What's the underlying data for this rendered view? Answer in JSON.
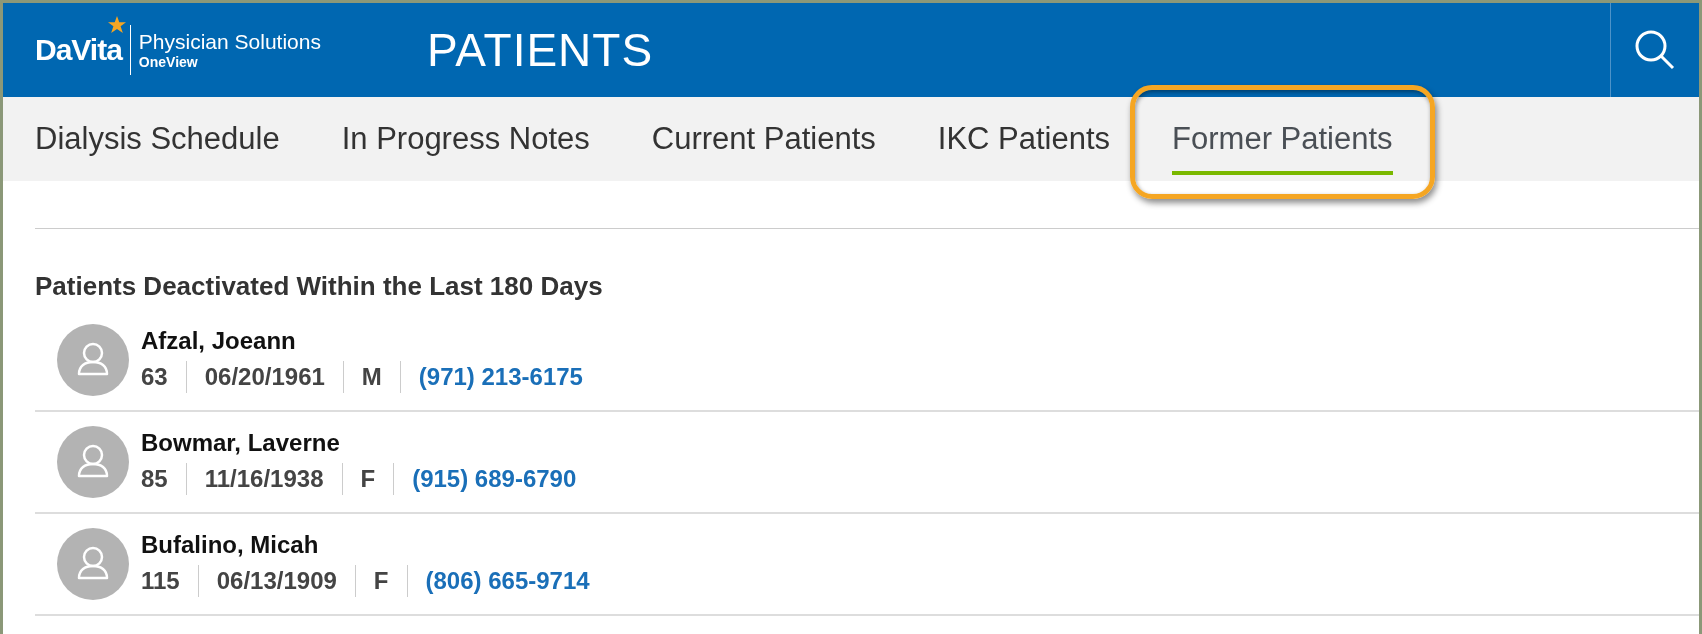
{
  "header": {
    "logo": {
      "brand": "DaVita",
      "product": "Physician Solutions",
      "edition": "OneView"
    },
    "title": "PATIENTS"
  },
  "tabs": [
    {
      "label": "Dialysis Schedule",
      "selected": false,
      "highlighted": false
    },
    {
      "label": "In Progress Notes",
      "selected": false,
      "highlighted": false
    },
    {
      "label": "Current Patients",
      "selected": false,
      "highlighted": false
    },
    {
      "label": "IKC Patients",
      "selected": false,
      "highlighted": false
    },
    {
      "label": "Former Patients",
      "selected": true,
      "highlighted": true
    }
  ],
  "section": {
    "heading": "Patients Deactivated Within the Last 180 Days"
  },
  "patients": [
    {
      "name": "Afzal, Joeann",
      "age": "63",
      "birth_date": "06/20/1961",
      "sex": "M",
      "phone": "(971) 213-6175"
    },
    {
      "name": "Bowmar, Laverne",
      "age": "85",
      "birth_date": "11/16/1938",
      "sex": "F",
      "phone": "(915) 689-6790"
    },
    {
      "name": "Bufalino, Micah",
      "age": "115",
      "birth_date": "06/13/1909",
      "sex": "F",
      "phone": "(806) 665-9714"
    }
  ]
}
